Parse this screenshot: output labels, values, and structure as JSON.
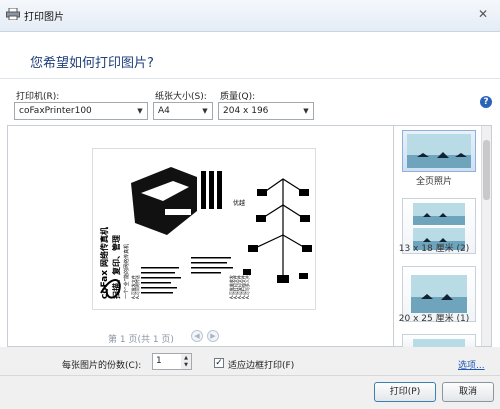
{
  "window": {
    "title": "打印图片",
    "close_glyph": "✕"
  },
  "header": {
    "headline": "您希望如何打印图片?"
  },
  "options": {
    "printer_label": "打印机(R):",
    "printer_value": "coFaxPrinter100",
    "paper_label": "纸张大小(S):",
    "paper_value": "A4",
    "quality_label": "质量(Q):",
    "quality_value": "204 x 196",
    "help_glyph": "?"
  },
  "preview": {
    "page_info": "第 1 页(共 1 页)",
    "prev_glyph": "◀",
    "next_glyph": "▶",
    "document": {
      "brand": "coFax",
      "title": "网络传真机",
      "subtitle": "扫描、复印、管理",
      "tagline": "一个“全”能的网络传真机",
      "side_title": "优越",
      "features": [
        "A.可批发文件",
        "A.可同时传送",
        "A.可批量收发",
        "A.可打印文件",
        "A.可复印文件",
        "A.可扫描文件",
        "A.可与多人共享"
      ]
    }
  },
  "layouts": [
    {
      "label": "全页照片",
      "selected": true
    },
    {
      "label": "13 x 18 厘米 (2)",
      "selected": false
    },
    {
      "label": "20 x 25 厘米 (1)",
      "selected": false
    }
  ],
  "footer": {
    "copies_label": "每张图片的份数(C):",
    "copies_value": "1",
    "fit_label": "适应边框打印(F)",
    "fit_checked": true,
    "options_link": "选项...",
    "print_button": "打印(P)",
    "cancel_button": "取消"
  },
  "colors": {
    "headline": "#1f3f7a",
    "link": "#1f57b7",
    "accent": "#2a63b8",
    "sky": "#b9dbe6",
    "water": "#6fa4bd"
  }
}
